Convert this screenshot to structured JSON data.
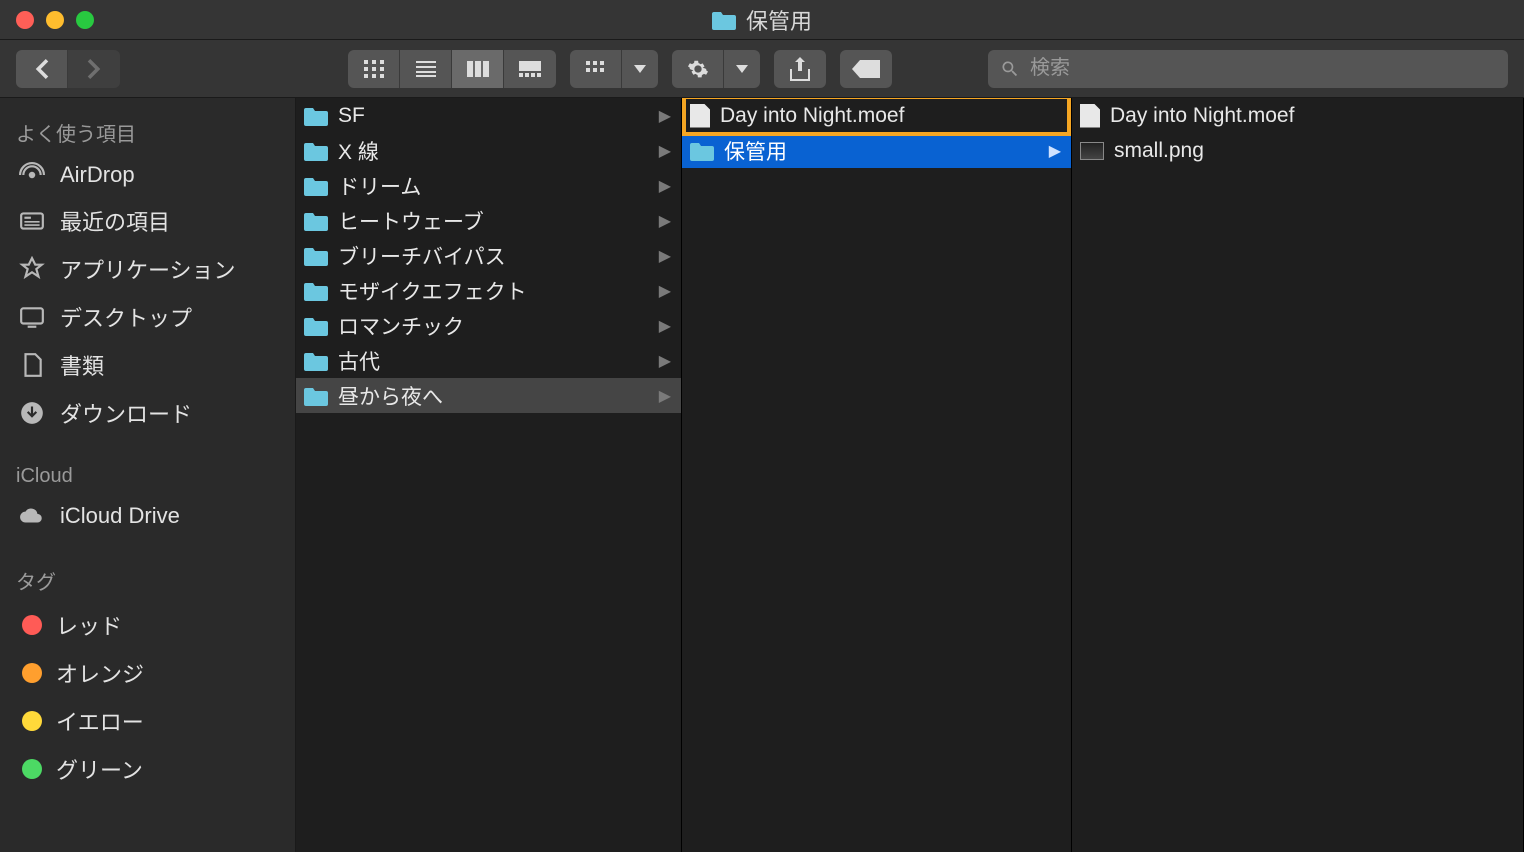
{
  "window_title": "保管用",
  "search_placeholder": "検索",
  "sidebar": {
    "section_favorites": "よく使う項目",
    "section_icloud": "iCloud",
    "section_tags": "タグ",
    "items": [
      {
        "label": "AirDrop"
      },
      {
        "label": "最近の項目"
      },
      {
        "label": "アプリケーション"
      },
      {
        "label": "デスクトップ"
      },
      {
        "label": "書類"
      },
      {
        "label": "ダウンロード"
      }
    ],
    "icloud_items": [
      {
        "label": "iCloud Drive"
      }
    ],
    "tags": [
      {
        "label": "レッド",
        "color": "#ff5b56"
      },
      {
        "label": "オレンジ",
        "color": "#ff9f2e"
      },
      {
        "label": "イエロー",
        "color": "#ffd93a"
      },
      {
        "label": "グリーン",
        "color": "#4cd964"
      }
    ]
  },
  "column1": [
    {
      "label": "SF"
    },
    {
      "label": "X 線"
    },
    {
      "label": "ドリーム"
    },
    {
      "label": "ヒートウェーブ"
    },
    {
      "label": "ブリーチバイパス"
    },
    {
      "label": "モザイクエフェクト"
    },
    {
      "label": "ロマンチック"
    },
    {
      "label": "古代"
    },
    {
      "label": "昼から夜へ"
    }
  ],
  "column2": [
    {
      "label": "Day into Night.moef",
      "type": "file"
    },
    {
      "label": "保管用",
      "type": "folder"
    }
  ],
  "column3": [
    {
      "label": "Day into Night.moef",
      "type": "file"
    },
    {
      "label": "small.png",
      "type": "image"
    }
  ],
  "highlight_color": "#f5a623"
}
